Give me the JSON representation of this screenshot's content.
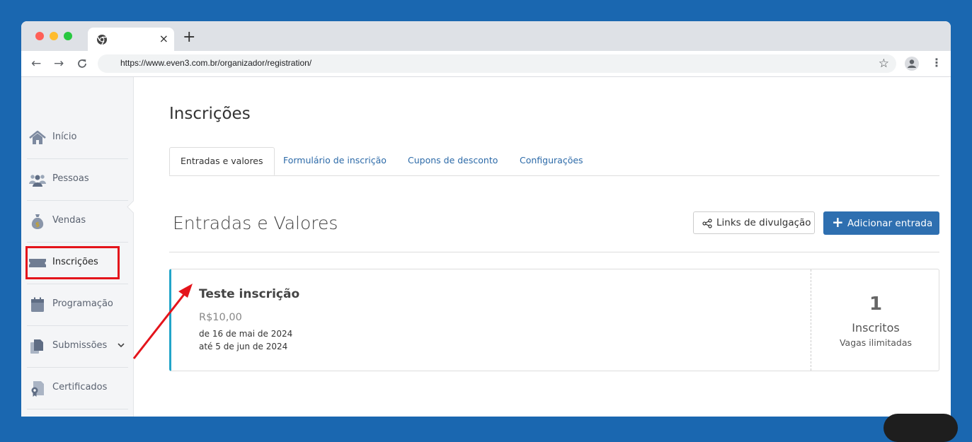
{
  "browser": {
    "url": "https://www.even3.com.br/organizador/registration/",
    "tab_close": "×",
    "new_tab": "+",
    "back": "←",
    "forward": "→",
    "reload": "C",
    "star": "☆",
    "menu": "⋮"
  },
  "sidebar": {
    "items": [
      {
        "label": "Início",
        "icon": "home-icon"
      },
      {
        "label": "Pessoas",
        "icon": "people-icon"
      },
      {
        "label": "Vendas",
        "icon": "money-bag-icon"
      },
      {
        "label": "Inscrições",
        "icon": "ticket-icon"
      },
      {
        "label": "Programação",
        "icon": "calendar-icon"
      },
      {
        "label": "Submissões",
        "icon": "documents-icon"
      },
      {
        "label": "Certificados",
        "icon": "certificate-icon"
      }
    ],
    "active": "Inscrições"
  },
  "main": {
    "title": "Inscrições",
    "tabs": [
      {
        "label": "Entradas e valores"
      },
      {
        "label": "Formulário de inscrição"
      },
      {
        "label": "Cupons de desconto"
      },
      {
        "label": "Configurações"
      }
    ],
    "section_title": "Entradas e Valores",
    "links_button": "Links de divulgação",
    "add_button": "Adicionar entrada",
    "add_button_icon": "+",
    "ticket": {
      "name": "Teste inscrição",
      "price": "R$10,00",
      "start": "de 16 de mai de 2024",
      "end": "até 5 de jun de 2024",
      "count": "1",
      "count_label": "Inscritos",
      "availability": "Vagas ilimitadas"
    }
  },
  "colors": {
    "background": "#1a67b0",
    "accent": "#2e6fb0",
    "highlight": "#e4141b",
    "card_border": "#22a5c9"
  }
}
